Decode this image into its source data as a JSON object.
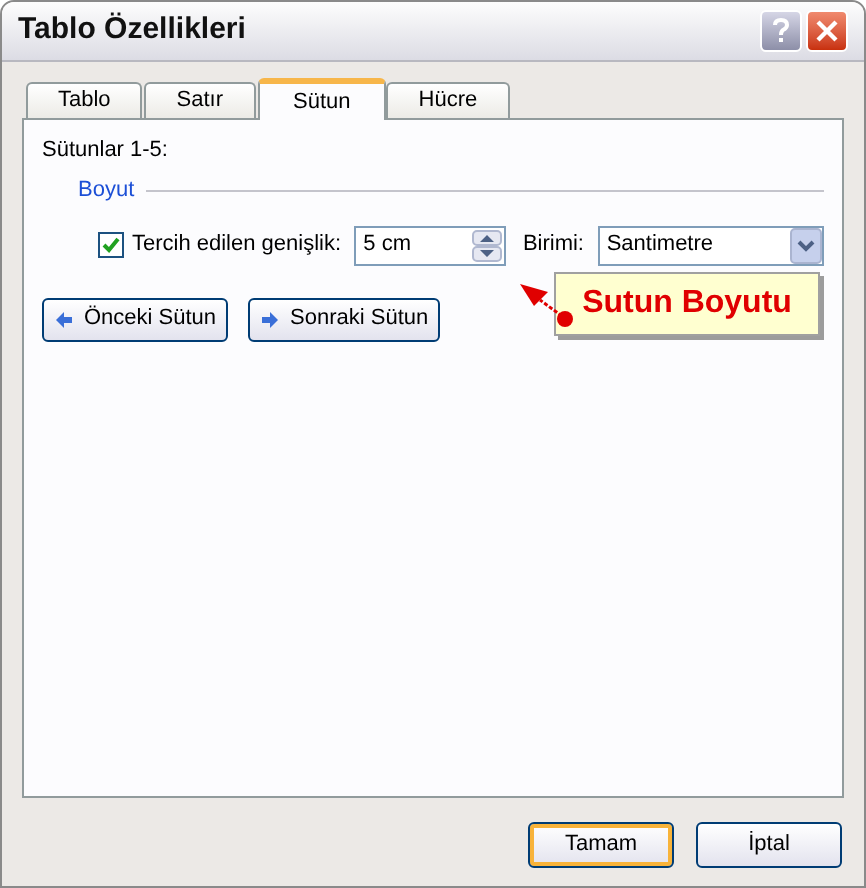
{
  "window": {
    "title": "Tablo Özellikleri"
  },
  "tabs": [
    {
      "label": "Tablo",
      "selected": false
    },
    {
      "label": "Satır",
      "selected": false
    },
    {
      "label": "Sütun",
      "selected": true
    },
    {
      "label": "Hücre",
      "selected": false
    }
  ],
  "section_label": "Sütunlar 1-5:",
  "group": {
    "title": "Boyut"
  },
  "preferred_width": {
    "label": "Tercih edilen genişlik:",
    "checked": true,
    "value": "5 cm"
  },
  "unit": {
    "label": "Birimi:",
    "value": "Santimetre"
  },
  "nav_buttons": [
    {
      "label": "Önceki Sütun",
      "kind": "previous"
    },
    {
      "label": "Sonraki Sütun",
      "kind": "next"
    }
  ],
  "callout": {
    "text": "Sutun Boyutu"
  },
  "buttons": [
    {
      "label": "Tamam",
      "default": true
    },
    {
      "label": "İptal",
      "default": false
    }
  ]
}
